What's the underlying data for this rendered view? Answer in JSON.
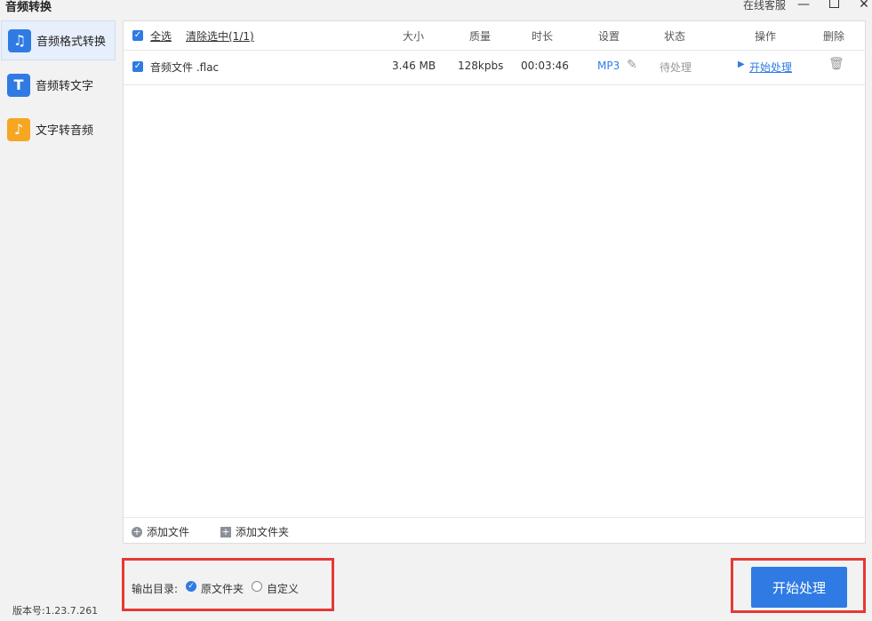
{
  "window": {
    "title": "音频转换",
    "service_label": "在线客服",
    "minimize": "—",
    "close": "✕"
  },
  "sidebar": {
    "items": [
      {
        "label": "音频格式转换",
        "icon": "music-convert-icon",
        "color": "#2f7be3",
        "active": true
      },
      {
        "label": "音频转文字",
        "icon": "text-t-icon",
        "color": "#2f7be3",
        "active": false
      },
      {
        "label": "文字转音频",
        "icon": "text-to-audio-icon",
        "color": "#f5a623",
        "active": false
      }
    ],
    "version": "版本号:1.23.7.261"
  },
  "table": {
    "select_all": "全选",
    "clear_selected": "清除选中(1/1)",
    "headers": {
      "size": "大小",
      "quality": "质量",
      "duration": "时长",
      "settings": "设置",
      "status": "状态",
      "action": "操作",
      "delete": "删除"
    },
    "rows": [
      {
        "name": "音频文件 .flac",
        "size": "3.46 MB",
        "quality": "128kpbs",
        "duration": "00:03:46",
        "format": "MP3",
        "status": "待处理",
        "action": "开始处理"
      }
    ]
  },
  "footer": {
    "add_file": "添加文件",
    "add_folder": "添加文件夹"
  },
  "output": {
    "label": "输出目录:",
    "option_original": "原文件夹",
    "option_custom": "自定义",
    "selected": "原文件夹"
  },
  "start_button": "开始处理",
  "colors": {
    "accent": "#2f7be3",
    "highlight_border": "#e53935"
  }
}
